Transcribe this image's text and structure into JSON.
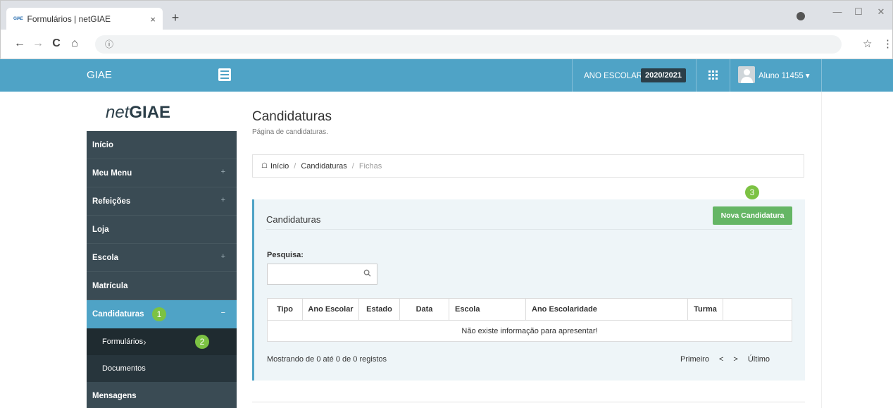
{
  "browser": {
    "tab_favicon": "GIAE",
    "tab_title": "Formulários | netGIAE",
    "tab_close": "×",
    "new_tab": "+",
    "url": "ⓘ",
    "min": "—",
    "max": "☐",
    "close": "✕",
    "back": "←",
    "forward": "→",
    "reload": "C",
    "home": "⌂",
    "star": "☆",
    "kebab": "⋮"
  },
  "header": {
    "brand": "GIAE",
    "year_label": "ANO ESCOLAR",
    "year_value": "2020/2021",
    "user": "Aluno 11455 ▾"
  },
  "logo": {
    "net": "net",
    "giae": "GIAE"
  },
  "sidebar": {
    "items": [
      {
        "label": "Início"
      },
      {
        "label": "Meu Menu",
        "marker": "+"
      },
      {
        "label": "Refeições",
        "marker": "+"
      },
      {
        "label": "Loja"
      },
      {
        "label": "Escola",
        "marker": "+"
      },
      {
        "label": "Matrícula"
      },
      {
        "label": "Candidaturas",
        "marker": "−",
        "badge": "1"
      },
      {
        "label": "Formulários",
        "marker": "›",
        "badge": "2"
      },
      {
        "label": "Documentos"
      },
      {
        "label": "Mensagens"
      }
    ]
  },
  "main": {
    "title": "Candidaturas",
    "subtitle": "Página de candidaturas.",
    "breadcrumb": [
      "Início",
      "Candidaturas",
      "Fichas"
    ],
    "breadcrumb_sep": "/",
    "panel_title": "Candidaturas",
    "new_button": "Nova Candidatura",
    "new_badge": "3",
    "search_label": "Pesquisa:",
    "search_value": "",
    "table": {
      "columns": [
        "Tipo",
        "Ano Escolar",
        "Estado",
        "Data",
        "Escola",
        "Ano Escolaridade",
        "Turma",
        ""
      ],
      "empty": "Não existe informação para apresentar!"
    },
    "info": "Mostrando de 0 até 0 de 0 registos",
    "pager": [
      "Primeiro",
      "<",
      ">",
      "Último"
    ]
  },
  "colors": {
    "header": "#4fa3c6",
    "sidebar": "#3a4b54",
    "active": "#4fa3c6",
    "badge": "#7cc243",
    "button": "#65b665"
  }
}
